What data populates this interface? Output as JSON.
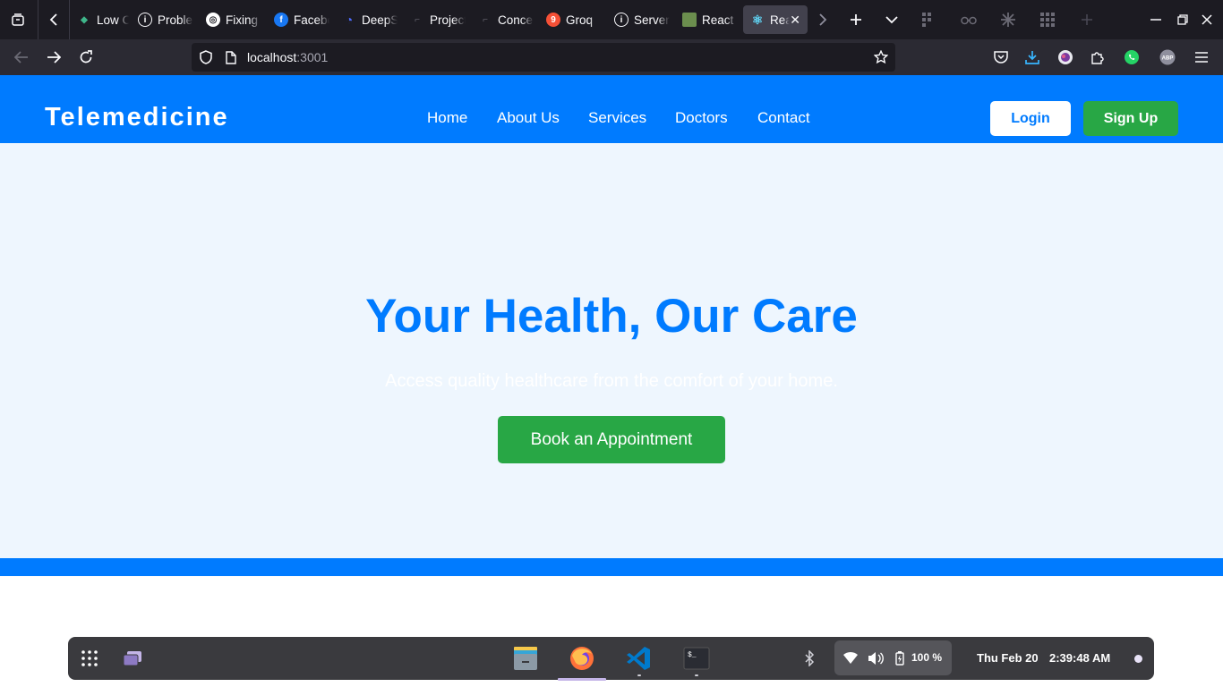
{
  "browser": {
    "tabs": [
      {
        "label": "Low Code",
        "favicon_color": "#3fb68b",
        "favicon_glyph": "◆"
      },
      {
        "label": "Problem",
        "favicon_color": "#1c1b22",
        "favicon_glyph": "i"
      },
      {
        "label": "Fixing",
        "favicon_color": "#ffffff",
        "favicon_glyph": "◎"
      },
      {
        "label": "Facebook",
        "favicon_color": "#1877f2",
        "favicon_glyph": "f"
      },
      {
        "label": "DeepSeek",
        "favicon_color": "#4d6bfe",
        "favicon_glyph": "◔"
      },
      {
        "label": "Project",
        "favicon_color": "#1c1b22",
        "favicon_glyph": "⌐"
      },
      {
        "label": "Concepts",
        "favicon_color": "#1c1b22",
        "favicon_glyph": "⌐"
      },
      {
        "label": "Groq",
        "favicon_color": "#f55036",
        "favicon_glyph": "9"
      },
      {
        "label": "Server",
        "favicon_color": "#1c1b22",
        "favicon_glyph": "i"
      },
      {
        "label": "React",
        "favicon_color": "#6b8e4e",
        "favicon_glyph": "▣"
      },
      {
        "label": "React App",
        "favicon_color": "#61dafb",
        "favicon_glyph": "⚛",
        "active": true
      }
    ],
    "url_host": "localhost",
    "url_port": ":3001"
  },
  "site": {
    "brand": "Telemedicine",
    "nav": [
      "Home",
      "About Us",
      "Services",
      "Doctors",
      "Contact"
    ],
    "login_label": "Login",
    "signup_label": "Sign Up",
    "hero_title": "Your Health, Our Care",
    "hero_subtitle": "Access quality healthcare from the comfort of your home.",
    "book_label": "Book an Appointment"
  },
  "taskbar": {
    "apps": [
      "files-icon",
      "firefox-icon",
      "vscode-icon",
      "terminal-icon"
    ],
    "battery": "100 %",
    "date": "Thu Feb 20",
    "time": "2:39:48 AM"
  },
  "colors": {
    "primary": "#007bff",
    "success": "#28a745",
    "hero_bg": "#eef6fe"
  }
}
